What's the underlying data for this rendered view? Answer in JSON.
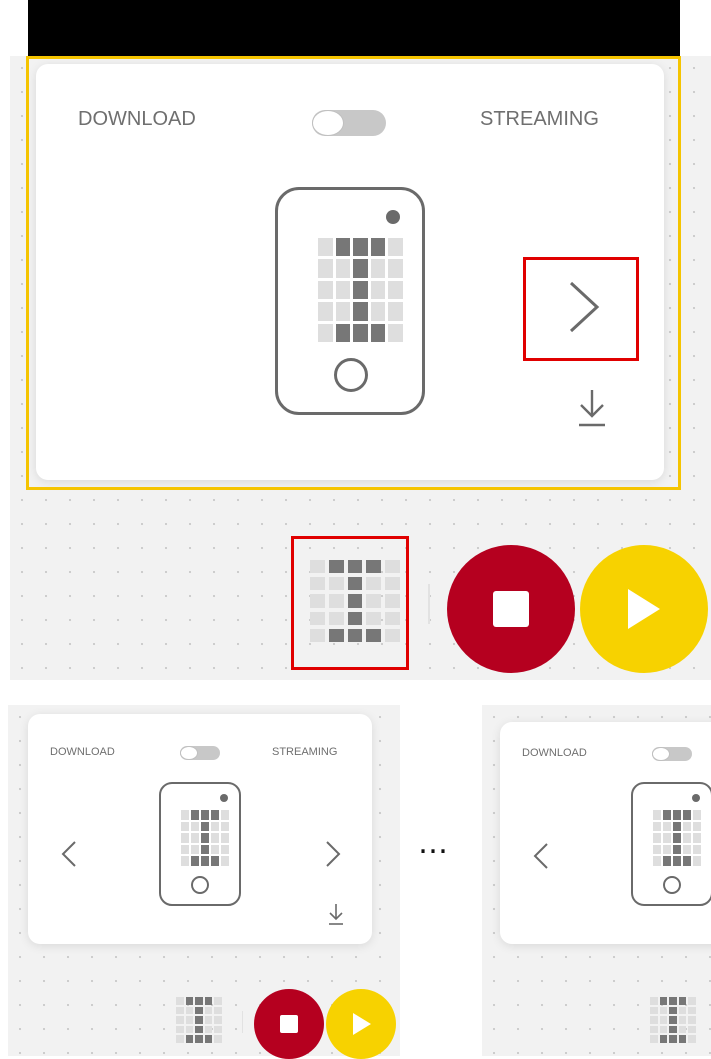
{
  "colors": {
    "stop_button": "#b5001f",
    "play_button": "#f7d200",
    "highlight_yellow": "#f5c400",
    "highlight_red": "#e00000"
  },
  "top_panel": {
    "download_label": "DOWNLOAD",
    "streaming_label": "STREAMING",
    "toggle_state": "download",
    "icons": [
      "phone-matrix-icon",
      "chevron-right-icon",
      "download-icon",
      "matrix-preview-icon",
      "stop-icon",
      "play-icon"
    ]
  },
  "bottom_left": {
    "download_label": "DOWNLOAD",
    "streaming_label": "STREAMING"
  },
  "ellipsis": "…",
  "bottom_right": {
    "download_label": "DOWNLOAD"
  },
  "matrix_pattern": [
    0,
    1,
    1,
    1,
    0,
    0,
    0,
    1,
    0,
    0,
    0,
    0,
    1,
    0,
    0,
    0,
    0,
    1,
    0,
    0,
    0,
    1,
    1,
    1,
    0
  ]
}
